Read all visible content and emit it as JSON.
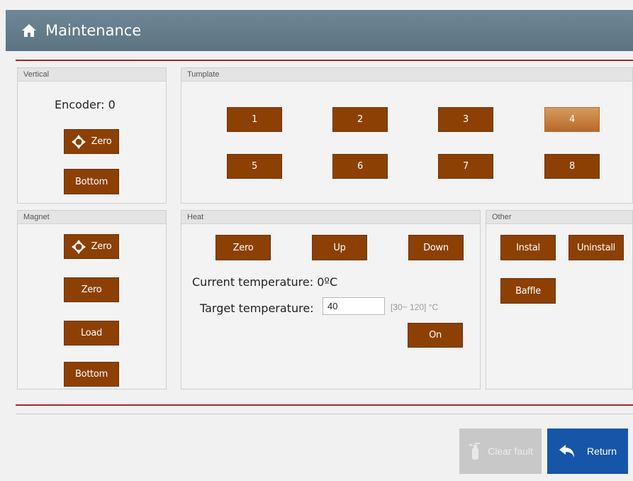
{
  "header": {
    "title": "Maintenance",
    "icon": "home-icon"
  },
  "vertical": {
    "title": "Vertical",
    "encoder": "Encoder: 0",
    "zero_label": "Zero",
    "bottom_label": "Bottom"
  },
  "template": {
    "title": "Tumplate",
    "buttons": [
      "1",
      "2",
      "3",
      "4",
      "5",
      "6",
      "7",
      "8"
    ],
    "selected": "4"
  },
  "magnet": {
    "title": "Magnet",
    "zero_icon_label": "Zero",
    "zero_label": "Zero",
    "load_label": "Load",
    "bottom_label": "Bottom"
  },
  "heat": {
    "title": "Heat",
    "zero_label": "Zero",
    "up_label": "Up",
    "down_label": "Down",
    "current_temp": "Current temperature: 0ºC",
    "target_label": "Target temperature:",
    "target_value": "40",
    "range_hint": "[30~ 120] °C",
    "on_label": "On"
  },
  "other": {
    "title": "Other",
    "install_label": "Instal",
    "uninstall_label": "Uninstall",
    "baffle_label": "Baffle"
  },
  "footer": {
    "clear_fault_label": "Clear fault",
    "return_label": "Return"
  },
  "colors": {
    "header": "#667e8c",
    "button": "#8c4004",
    "button_active": "#c98240",
    "rule": "#a3262a",
    "return_bg": "#1655a8",
    "disabled_bg": "#c8c8c8"
  }
}
